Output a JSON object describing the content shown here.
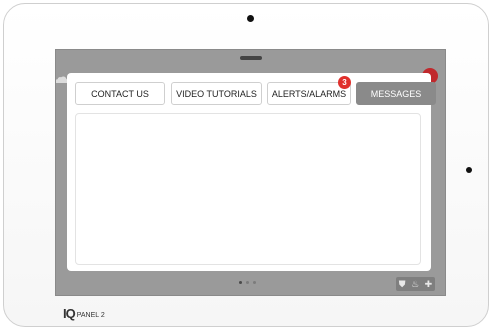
{
  "tabs": [
    {
      "label": "CONTACT US",
      "active": false
    },
    {
      "label": "VIDEO TUTORIALS",
      "active": false
    },
    {
      "label": "ALERTS/ALARMS",
      "active": false,
      "badge": "3"
    },
    {
      "label": "MESSAGES",
      "active": true
    }
  ],
  "page_indicator": {
    "count": 3,
    "current": 1
  },
  "brand": {
    "mark": "IQ",
    "model": "PANEL 2"
  },
  "status_icons": [
    "shield-icon",
    "flame-icon",
    "medical-cross-icon"
  ],
  "colors": {
    "badge": "#e0302c",
    "active_tab": "#8a8a8a",
    "screen_background": "#9a9a9a"
  }
}
